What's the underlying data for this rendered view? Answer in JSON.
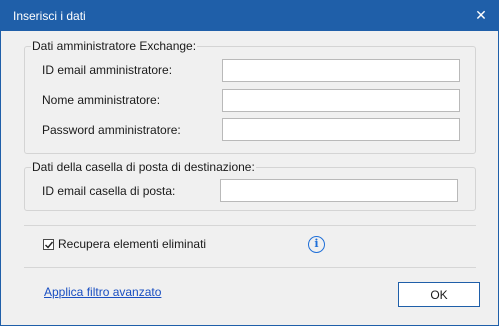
{
  "window": {
    "title": "Inserisci i dati",
    "close_icon": "close-icon",
    "close_glyph": "✕"
  },
  "admin_group": {
    "legend": "Dati amministratore Exchange:",
    "fields": [
      {
        "label": "ID email amministratore:",
        "value": ""
      },
      {
        "label": "Nome amministratore:",
        "value": ""
      },
      {
        "label": "Password amministratore:",
        "value": ""
      }
    ]
  },
  "destination_group": {
    "legend": "Dati della casella di posta di destinazione:",
    "fields": [
      {
        "label": "ID email casella di posta:",
        "value": ""
      }
    ]
  },
  "options": {
    "recover_deleted_label": "Recupera elementi eliminati",
    "recover_deleted_checked": true,
    "info_icon": "info-icon",
    "info_glyph": "i"
  },
  "footer": {
    "advanced_filter_link": "Applica filtro avanzato",
    "ok_label": "OK"
  },
  "colors": {
    "titlebar": "#1f5fa9",
    "link": "#1a4fc2",
    "info": "#1f6fd8"
  }
}
